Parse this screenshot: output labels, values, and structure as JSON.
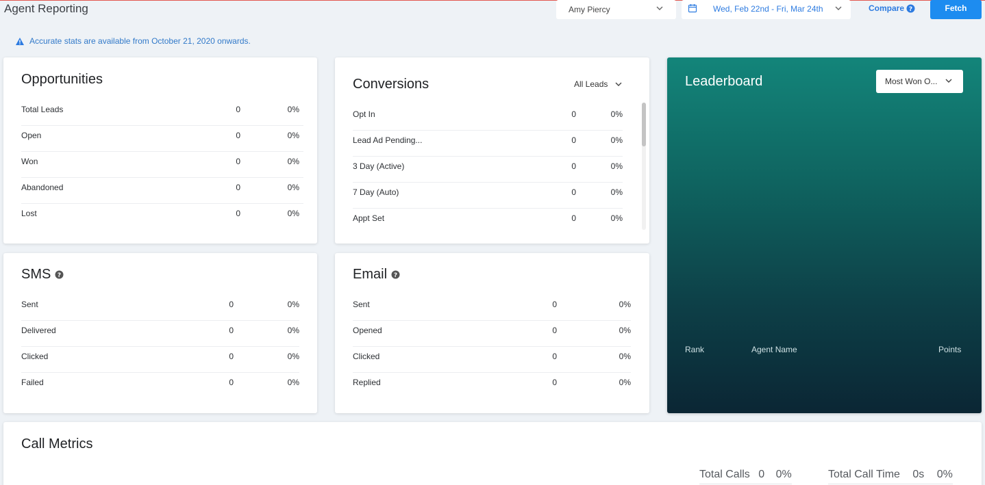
{
  "header": {
    "title": "Agent Reporting",
    "agent": "Amy Piercy",
    "date_range": "Wed, Feb 22nd - Fri, Mar 24th",
    "compare_label": "Compare",
    "fetch_label": "Fetch"
  },
  "notice": "Accurate stats are available from October 21, 2020 onwards.",
  "opportunities": {
    "title": "Opportunities",
    "rows": [
      {
        "label": "Total Leads",
        "value": "0",
        "pct": "0%"
      },
      {
        "label": "Open",
        "value": "0",
        "pct": "0%"
      },
      {
        "label": "Won",
        "value": "0",
        "pct": "0%"
      },
      {
        "label": "Abandoned",
        "value": "0",
        "pct": "0%"
      },
      {
        "label": "Lost",
        "value": "0",
        "pct": "0%"
      }
    ]
  },
  "conversions": {
    "title": "Conversions",
    "filter": "All Leads",
    "rows": [
      {
        "label": "Opt In",
        "value": "0",
        "pct": "0%"
      },
      {
        "label": "Lead Ad Pending...",
        "value": "0",
        "pct": "0%"
      },
      {
        "label": "3 Day (Active)",
        "value": "0",
        "pct": "0%"
      },
      {
        "label": "7 Day (Auto)",
        "value": "0",
        "pct": "0%"
      },
      {
        "label": "Appt Set",
        "value": "0",
        "pct": "0%"
      }
    ]
  },
  "sms": {
    "title": "SMS",
    "rows": [
      {
        "label": "Sent",
        "value": "0",
        "pct": "0%"
      },
      {
        "label": "Delivered",
        "value": "0",
        "pct": "0%"
      },
      {
        "label": "Clicked",
        "value": "0",
        "pct": "0%"
      },
      {
        "label": "Failed",
        "value": "0",
        "pct": "0%"
      }
    ]
  },
  "email": {
    "title": "Email",
    "rows": [
      {
        "label": "Sent",
        "value": "0",
        "pct": "0%"
      },
      {
        "label": "Opened",
        "value": "0",
        "pct": "0%"
      },
      {
        "label": "Clicked",
        "value": "0",
        "pct": "0%"
      },
      {
        "label": "Replied",
        "value": "0",
        "pct": "0%"
      }
    ]
  },
  "leaderboard": {
    "title": "Leaderboard",
    "sort": "Most Won O...",
    "columns": [
      "Rank",
      "Agent Name",
      "Points"
    ]
  },
  "call_metrics": {
    "title": "Call Metrics",
    "total_calls_label": "Total Calls",
    "total_calls_value": "0",
    "total_calls_pct": "0%",
    "total_time_label": "Total Call Time",
    "total_time_value": "0s",
    "total_time_pct": "0%"
  },
  "colors": {
    "accent": "#1d8cf0",
    "link": "#2d7be0",
    "leaderboard_top": "#13857a",
    "leaderboard_bottom": "#0b2634"
  }
}
